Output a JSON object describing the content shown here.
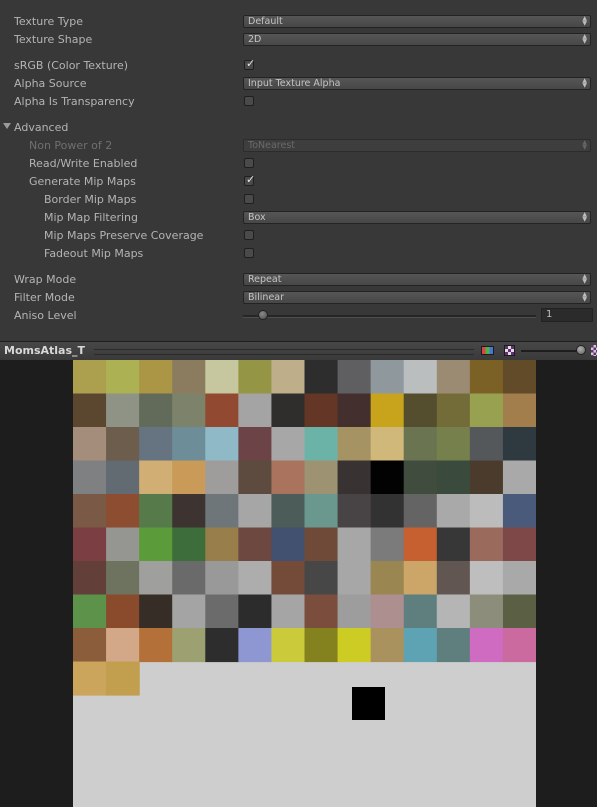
{
  "inspector": {
    "texture_type": {
      "label": "Texture Type",
      "value": "Default"
    },
    "texture_shape": {
      "label": "Texture Shape",
      "value": "2D"
    },
    "srgb": {
      "label": "sRGB (Color Texture)",
      "checked": true
    },
    "alpha_source": {
      "label": "Alpha Source",
      "value": "Input Texture Alpha"
    },
    "alpha_is_transparency": {
      "label": "Alpha Is Transparency",
      "checked": false
    },
    "advanced": {
      "label": "Advanced",
      "expanded": true
    },
    "non_power_of_2": {
      "label": "Non Power of 2",
      "value": "ToNearest",
      "disabled": true
    },
    "read_write": {
      "label": "Read/Write Enabled",
      "checked": false
    },
    "generate_mips": {
      "label": "Generate Mip Maps",
      "checked": true
    },
    "border_mips": {
      "label": "Border Mip Maps",
      "checked": false
    },
    "mip_filtering": {
      "label": "Mip Map Filtering",
      "value": "Box"
    },
    "mip_preserve_coverage": {
      "label": "Mip Maps Preserve Coverage",
      "checked": false
    },
    "fadeout_mips": {
      "label": "Fadeout Mip Maps",
      "checked": false
    },
    "wrap_mode": {
      "label": "Wrap Mode",
      "value": "Repeat"
    },
    "filter_mode": {
      "label": "Filter Mode",
      "value": "Bilinear"
    },
    "aniso_level": {
      "label": "Aniso Level",
      "value": "1",
      "slider_min": 0,
      "slider_max": 16
    }
  },
  "preview": {
    "title": "MomsAtlas_T",
    "rgb_icon": "rgb-channel-icon",
    "alpha_icon": "alpha-channel-icon",
    "mip_level": 0,
    "texture_background": "#cecece",
    "palette_rows": [
      [
        "#aca04f",
        "#acb153",
        "#ab9645",
        "#8b7c5f",
        "#c6c79e",
        "#949645",
        "#bfae8a",
        "#2d2d2d",
        "#5f5f61",
        "#8f989d",
        "#babebf",
        "#9c8b73",
        "#7b6126",
        "#614b29"
      ],
      [
        "#5b4630",
        "#8f9385",
        "#626b59",
        "#7d836a",
        "#924931",
        "#a5a4a4",
        "#302e2c",
        "#633626",
        "#422f2e",
        "#c8a31c",
        "#544d2e",
        "#736c38",
        "#98a150",
        "#a17e4c"
      ],
      [
        "#a48d7b",
        "#6c5d4c",
        "#667380",
        "#6d8d99",
        "#8fb9c6",
        "#6c4447",
        "#a7a7a7",
        "#6cb3a7",
        "#a59363",
        "#cfb879",
        "#6a7451",
        "#75804d",
        "#54585b",
        "#2e3a40"
      ],
      [
        "#7e8081",
        "#626a72",
        "#d1ae73",
        "#c99a58",
        "#9f9d9b",
        "#5d4b3f",
        "#a9735d",
        "#9d9271",
        "#383233",
        "#020202",
        "#3f4c3e",
        "#3a4a3c",
        "#4b3b2d",
        "#a9a9a9"
      ],
      [
        "#7a5a46",
        "#8c4d30",
        "#577a4a",
        "#3d3431",
        "#6e767a",
        "#a6a6a6",
        "#4c5c58",
        "#6a988f",
        "#484445",
        "#323232",
        "#646464",
        "#a9a9a9",
        "#bcbcbc",
        "#4a5a7a"
      ],
      [
        "#7b3f43",
        "#959591",
        "#5b9b3a",
        "#3c6d3a",
        "#987e4b",
        "#6d4840",
        "#435170",
        "#6f4a39",
        "#a7a7a7",
        "#7b7b7b",
        "#c76030",
        "#373737",
        "#9a6a5c",
        "#7d4847"
      ],
      [
        "#633f3a",
        "#6d735e",
        "#9f9f9d",
        "#6a6a6a",
        "#999999",
        "#adadad",
        "#744a38",
        "#474747",
        "#a7a7a7",
        "#9a8650",
        "#cca669",
        "#625652",
        "#bebebe",
        "#a9a9a9"
      ],
      [
        "#5d924a",
        "#8a4b2d",
        "#372d27",
        "#a4a4a4",
        "#6b6b6b",
        "#2c2c2c",
        "#a5a5a5",
        "#7b4d3d",
        "#9d9d9d",
        "#ad8f8f",
        "#5f7f7f",
        "#b5b5b5",
        "#8d8d7c",
        "#5b6045"
      ],
      [
        "#8b5d3a",
        "#d2a889",
        "#b37039",
        "#9da070",
        "#2d2d2d",
        "#8e97d2",
        "#cbca3b",
        "#84821f",
        "#cccc25",
        "#aa925f",
        "#5ea3b4",
        "#5f7f7f",
        "#cf6bc0",
        "#cb6a9f"
      ],
      [
        "#caa55b",
        "#c29e4f"
      ]
    ],
    "dark_marker_color": "#000000"
  }
}
